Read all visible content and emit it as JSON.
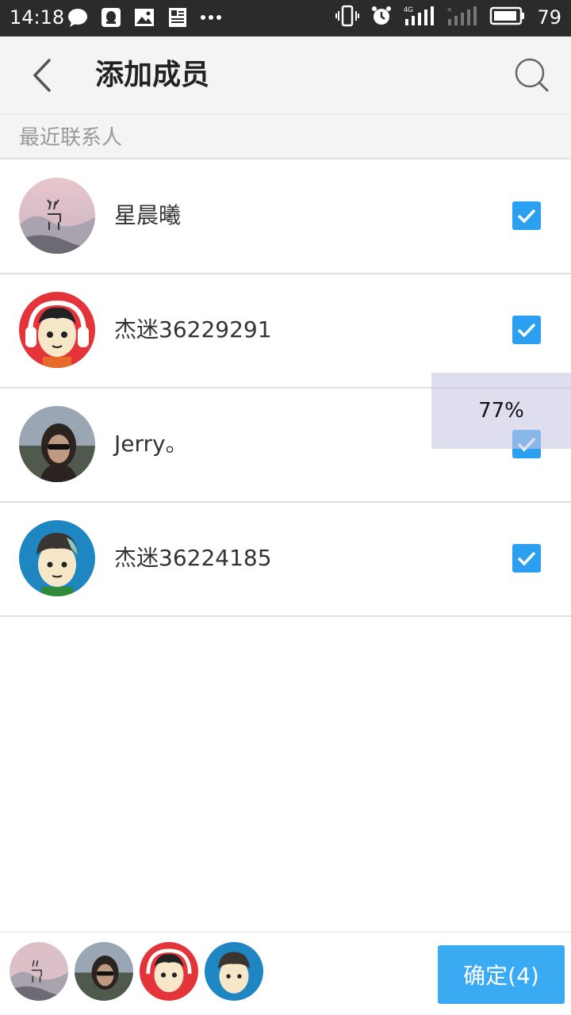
{
  "status_bar": {
    "time": "14:18",
    "battery": "79",
    "network": "4G",
    "icons": [
      "wechat-icon",
      "qq-icon",
      "gallery-icon",
      "news-icon",
      "more-dots-icon",
      "vibrate-icon",
      "alarm-icon",
      "signal-icon",
      "battery-icon"
    ]
  },
  "header": {
    "title": "添加成员",
    "back_icon": "chevron-left-icon",
    "search_icon": "search-icon"
  },
  "section": {
    "title": "最近联系人"
  },
  "contacts": [
    {
      "name": "星晨曦",
      "avatar": "deer-landscape-avatar",
      "checked": true
    },
    {
      "name": "杰迷36229291",
      "avatar": "cartoon-headphones-avatar",
      "checked": true
    },
    {
      "name": "Jerry。",
      "avatar": "photo-woman-avatar",
      "checked": true
    },
    {
      "name": "杰迷36224185",
      "avatar": "cartoon-boy-avatar",
      "checked": true
    }
  ],
  "overlay": {
    "progress_text": "77%"
  },
  "bottom": {
    "selected": [
      "deer-landscape-avatar",
      "photo-woman-avatar",
      "cartoon-headphones-avatar",
      "cartoon-boy-avatar"
    ],
    "confirm_label": "确定(4)"
  },
  "colors": {
    "accent": "#2b9ff0",
    "confirm_bg": "#3aabf3",
    "status_bar": "#2b2b2b",
    "header_bg": "#f4f4f4"
  }
}
